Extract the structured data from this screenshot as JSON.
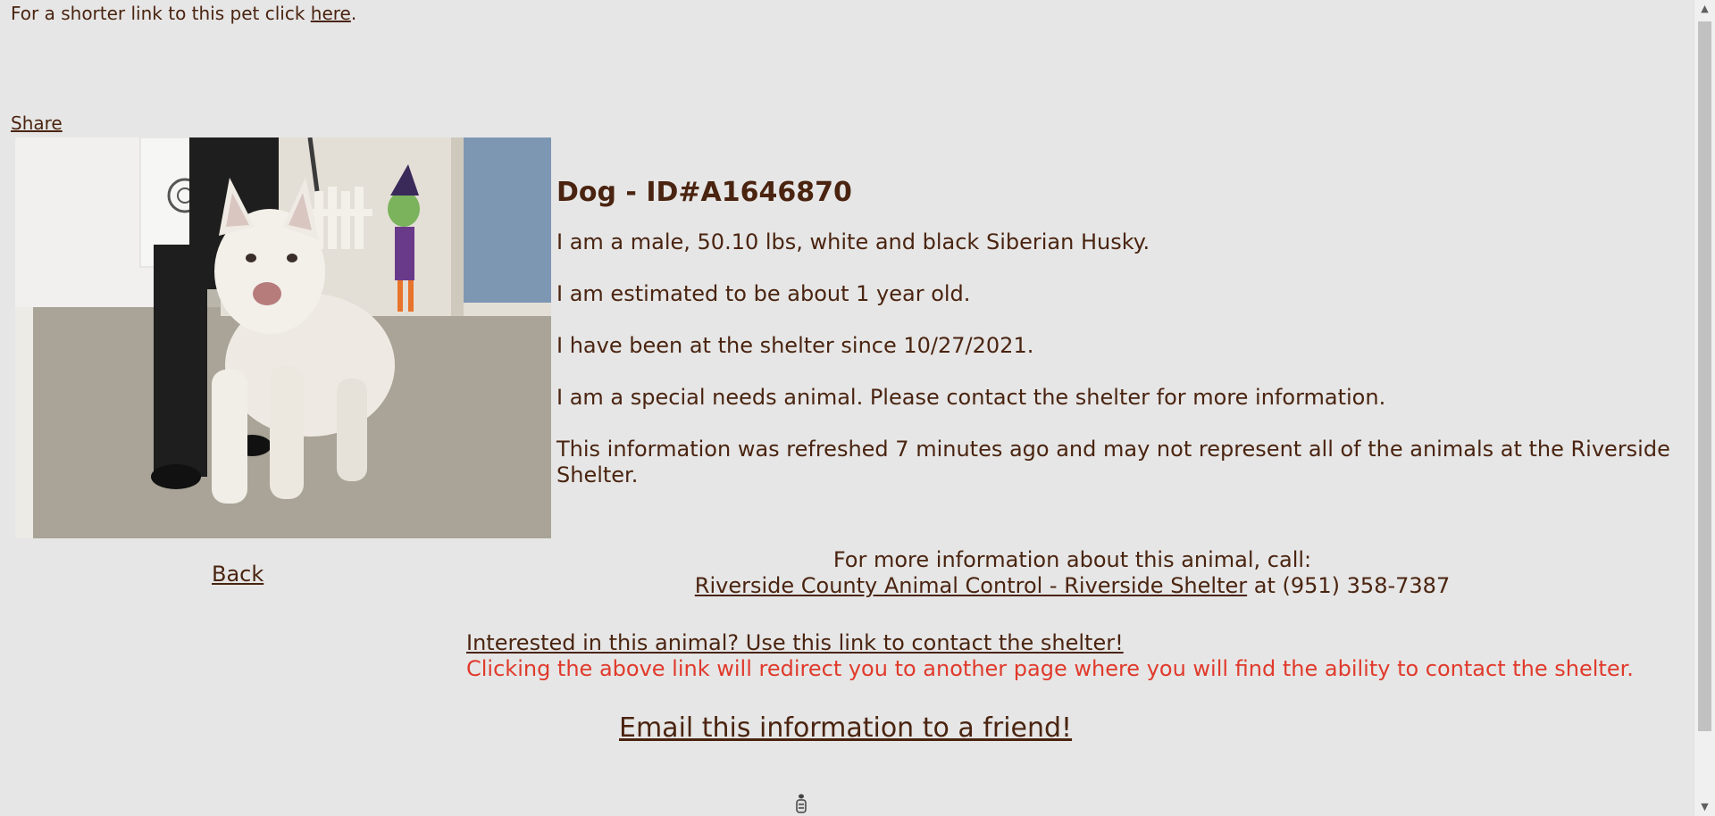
{
  "short_link": {
    "prefix": "For a shorter link to this pet click ",
    "link_label": "here",
    "suffix": "."
  },
  "share_label": "Share",
  "back_label": "Back",
  "animal": {
    "heading": "Dog - ID#A1646870",
    "lines": [
      "I am a male, 50.10 lbs, white and black Siberian Husky.",
      "I am estimated to be about 1 year old.",
      "I have been at the shelter since 10/27/2021.",
      "I am a special needs animal. Please contact the shelter for more information.",
      "This information was refreshed 7 minutes ago and may not represent all of the animals at the Riverside Shelter."
    ]
  },
  "contact": {
    "intro": "For more information about this animal, call:",
    "shelter_link": "Riverside County Animal Control - Riverside Shelter",
    "phone_text": " at (951) 358-7387"
  },
  "interest": {
    "link_label": "Interested in this animal? Use this link to contact the shelter!",
    "warning": "Clicking the above link will redirect you to another page where you will find the ability to contact the shelter."
  },
  "email_label": "Email this information to a friend!",
  "icons": {
    "loading": "loading-icon",
    "scroll_up": "scroll-up-arrow-icon",
    "scroll_down": "scroll-down-arrow-icon"
  },
  "colors": {
    "background": "#e6e6e6",
    "text": "#4a2410",
    "warning": "#e03a2b"
  }
}
